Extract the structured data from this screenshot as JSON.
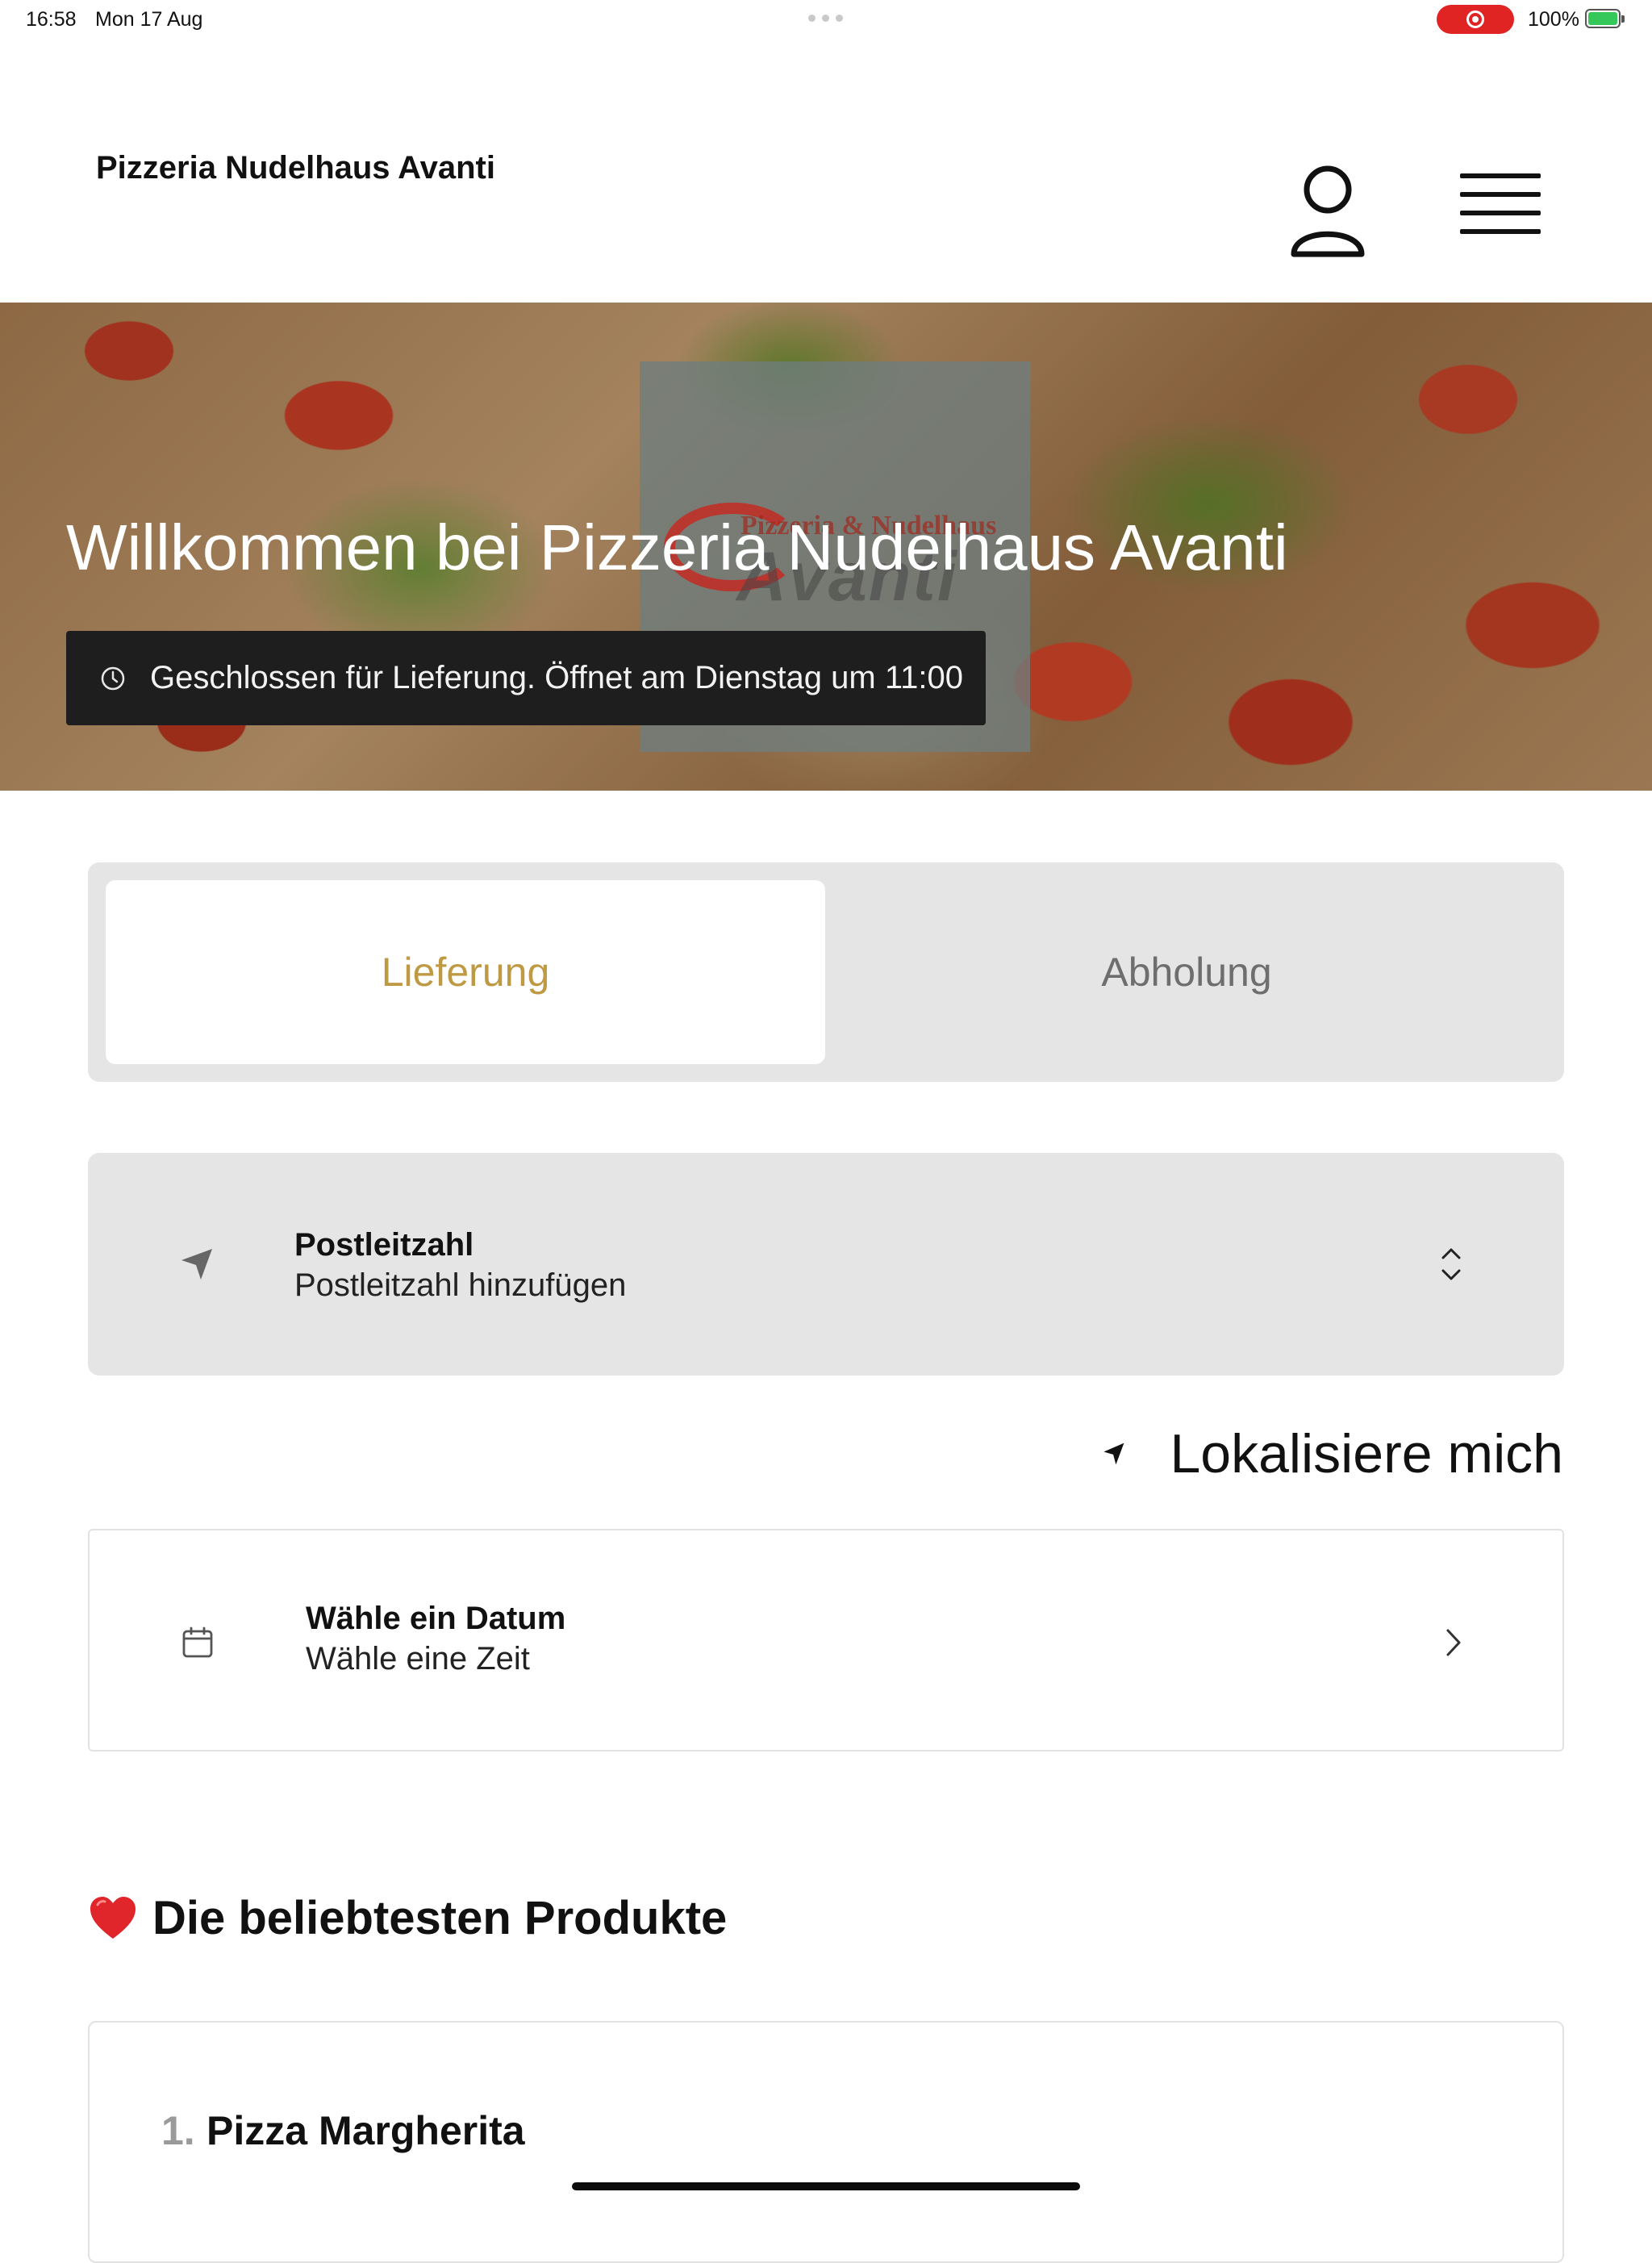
{
  "status_bar": {
    "time": "16:58",
    "date": "Mon 17 Aug",
    "battery_percent": "100%",
    "recording_color": "#e02424",
    "battery_color": "#34c759"
  },
  "header": {
    "title": "Pizzeria Nudelhaus Avanti",
    "account_icon": "person-icon",
    "menu_icon": "hamburger-menu-icon"
  },
  "hero": {
    "title": "Willkommen bei Pizzeria Nudelhaus Avanti",
    "status_text": "Geschlossen für Lieferung. Öffnet am Dienstag um 11:00",
    "status_icon": "clock-icon",
    "logo_lettering_small": "Pizzeria & Nudelhaus",
    "logo_lettering_large": "Avanti"
  },
  "order_mode": {
    "options": [
      {
        "label": "Lieferung",
        "selected": true
      },
      {
        "label": "Abholung",
        "selected": false
      }
    ],
    "active_color": "#bf9a45"
  },
  "postcode": {
    "title": "Postleitzahl",
    "placeholder": "Postleitzahl hinzufügen",
    "icon": "navigation-arrow-icon"
  },
  "locate": {
    "label": "Lokalisiere mich",
    "icon": "location-arrow-icon"
  },
  "schedule": {
    "date_label": "Wähle ein Datum",
    "time_label": "Wähle eine Zeit",
    "icon": "calendar-icon"
  },
  "popular": {
    "heading": "Die beliebtesten Produkte",
    "icon": "heart-icon",
    "items": [
      {
        "rank": "1.",
        "name": "Pizza Margherita"
      }
    ]
  }
}
